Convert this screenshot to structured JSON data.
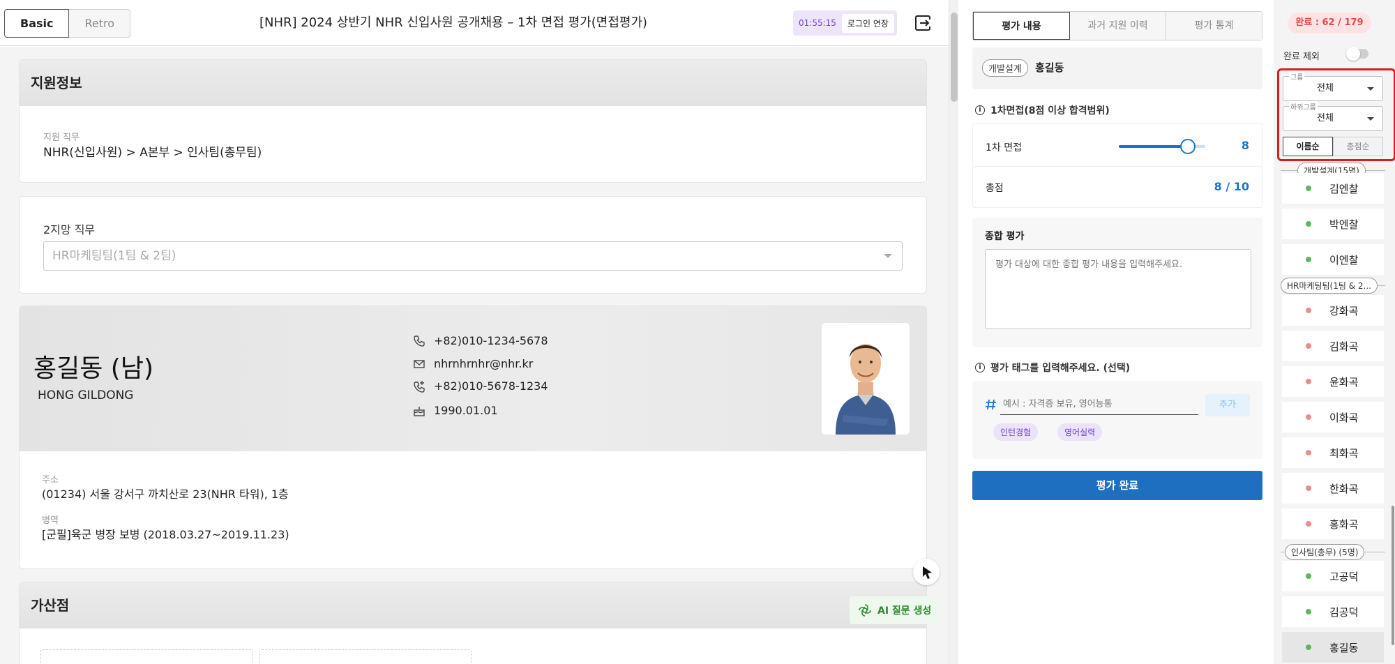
{
  "header": {
    "mode_basic": "Basic",
    "mode_retro": "Retro",
    "title": "[NHR] 2024 상반기 NHR 신입사원 공개채용 – 1차 면접 평가(면접평가)",
    "timer": "01:55:15",
    "extend_label": "로그인 연장"
  },
  "apply_info": {
    "section_title": "지원정보",
    "job_label": "지원 직무",
    "job_value": "NHR(신입사원) > A본부 > 인사팀(총무팀)"
  },
  "second_choice": {
    "label": "2지망 직무",
    "value": "HR마케팅팀(1팀 & 2팀)"
  },
  "profile": {
    "name": "홍길동 (남)",
    "eng_name": "HONG GILDONG",
    "phone": "+82)010-1234-5678",
    "email": "nhrnhrnhr@nhr.kr",
    "phone2": "+82)010-5678-1234",
    "birth": "1990.01.01",
    "address_label": "주소",
    "address": "(01234) 서울 강서구 까치산로 23(NHR 타워), 1층",
    "military_label": "병역",
    "military": "[군필]육군 병장 보병 (2018.03.27~2019.11.23)"
  },
  "bonus": {
    "section_title": "가산점",
    "ai_button": "AI 질문 생성"
  },
  "mid_panel": {
    "tabs": [
      "평가 내용",
      "과거 지원 이력",
      "평가 통계"
    ],
    "candidate_tag": "개발설계",
    "candidate_name": "홍길동",
    "score_section": "1차면접(8점 이상 합격범위)",
    "score_label": "1차 면접",
    "score_value": "8",
    "score_fraction": 0.8,
    "total_label": "총점",
    "total_value": "8 / 10",
    "overall_label": "종합 평가",
    "overall_placeholder": "평가 대상에 대한 종합 평가 내용을 입력해주세요.",
    "tag_section": "평가 태그를 입력해주세요. (선택)",
    "tag_placeholder": "예시 : 자격증 보유, 영어능통",
    "add_label": "추가",
    "chips": [
      "인턴경험",
      "영어실력"
    ],
    "complete_label": "평가 완료"
  },
  "right_panel": {
    "done_label": "완료 : 62 / 179",
    "exclude_label": "완료 제외",
    "group_legend": "그룹",
    "group_value": "전체",
    "subgroup_legend": "하위그룹",
    "subgroup_value": "전체",
    "sort_name": "이름순",
    "sort_total": "총점순",
    "groups": [
      {
        "label": "개발설계(15명)",
        "dot": "#5cb85c",
        "people": [
          "김엔찰",
          "박엔찰",
          "이엔찰"
        ]
      },
      {
        "label": "HR마케팅팀(1팀 & 2...",
        "dot": "#f08a8a",
        "people": [
          "강화곡",
          "김화곡",
          "윤화곡",
          "이화곡",
          "최화곡",
          "한화곡",
          "홍화곡"
        ]
      },
      {
        "label": "인사팀(총무)  (5명)",
        "dot": "#5cb85c",
        "people": [
          "고공덕",
          "김공덕",
          "홍길동"
        ]
      }
    ]
  },
  "icons": {
    "logout": "logout-icon",
    "phone": "phone-icon",
    "mail": "mail-icon",
    "phone_plus": "phone-plus-icon",
    "cake": "cake-icon",
    "info": "info-icon",
    "hash": "hash-icon",
    "cursor": "cursor-icon",
    "ai": "openai-icon"
  },
  "colors": {
    "accent": "#1f6fc0",
    "highlight": "#e01a1a",
    "done_dot": "#5cb85c",
    "pending_dot": "#f08a8a"
  }
}
